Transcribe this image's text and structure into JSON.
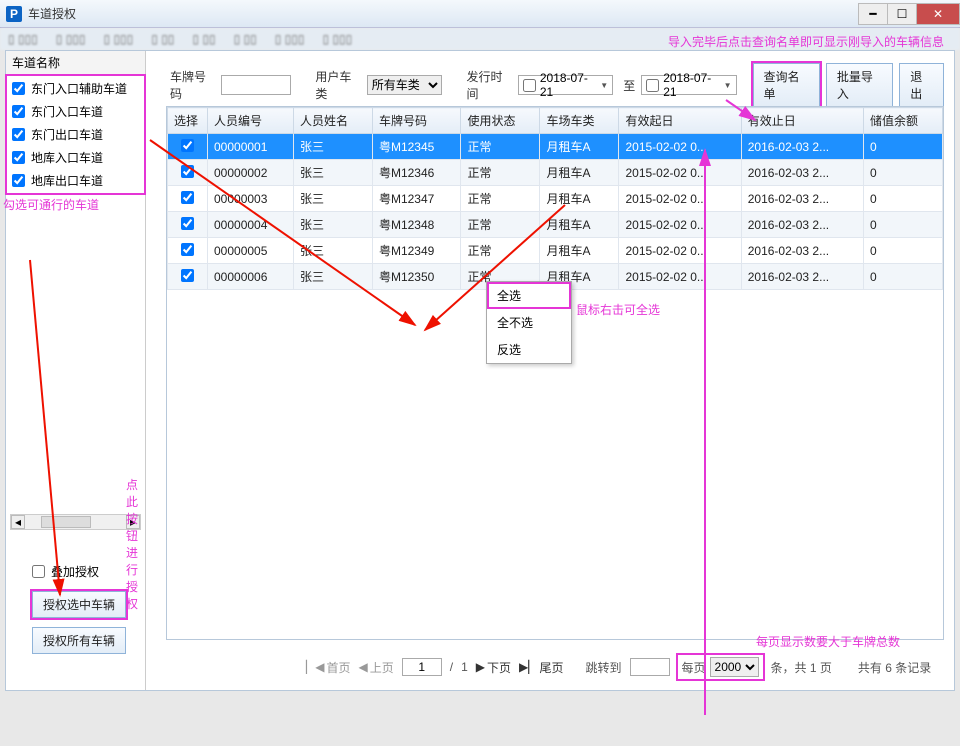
{
  "window": {
    "title": "车道授权"
  },
  "sidebar": {
    "heading": "车道名称",
    "lanes": [
      "东门入口辅助车道",
      "东门入口车道",
      "东门出口车道",
      "地库入口车道",
      "地库出口车道"
    ]
  },
  "annotations": {
    "top_note": "导入完毕后点击查询名单即可显示刚导入的车辆信息",
    "lane_note": "勾选可通行的车道",
    "ctx_note": "鼠标右击可全选",
    "pager_note": "每页显示数要大于车牌总数",
    "auth_note": "点此按钮进行授权"
  },
  "filters": {
    "plate_label": "车牌号码",
    "plate_value": "",
    "user_class_label": "用户车类",
    "user_class_value": "所有车类",
    "issue_time_label": "发行时间",
    "date_from": "2018-07-21",
    "to_label": "至",
    "date_to": "2018-07-21"
  },
  "buttons": {
    "query": "查询名单",
    "batch_import": "批量导入",
    "exit": "退出",
    "auth_selected": "授权选中车辆",
    "auth_all": "授权所有车辆",
    "stack_auth": "叠加授权"
  },
  "table": {
    "headers": [
      "选择",
      "人员编号",
      "人员姓名",
      "车牌号码",
      "使用状态",
      "车场车类",
      "有效起日",
      "有效止日",
      "储值余额"
    ],
    "rows": [
      {
        "sel": true,
        "id": "00000001",
        "name": "张三",
        "plate": "粤M12345",
        "status": "正常",
        "cls": "月租车A",
        "start": "2015-02-02 0...",
        "end": "2016-02-03 2...",
        "bal": "0",
        "selected": true
      },
      {
        "sel": true,
        "id": "00000002",
        "name": "张三",
        "plate": "粤M12346",
        "status": "正常",
        "cls": "月租车A",
        "start": "2015-02-02 0...",
        "end": "2016-02-03 2...",
        "bal": "0"
      },
      {
        "sel": true,
        "id": "00000003",
        "name": "张三",
        "plate": "粤M12347",
        "status": "正常",
        "cls": "月租车A",
        "start": "2015-02-02 0...",
        "end": "2016-02-03 2...",
        "bal": "0"
      },
      {
        "sel": true,
        "id": "00000004",
        "name": "张三",
        "plate": "粤M12348",
        "status": "正常",
        "cls": "月租车A",
        "start": "2015-02-02 0...",
        "end": "2016-02-03 2...",
        "bal": "0"
      },
      {
        "sel": true,
        "id": "00000005",
        "name": "张三",
        "plate": "粤M12349",
        "status": "正常",
        "cls": "月租车A",
        "start": "2015-02-02 0...",
        "end": "2016-02-03 2...",
        "bal": "0"
      },
      {
        "sel": true,
        "id": "00000006",
        "name": "张三",
        "plate": "粤M12350",
        "status": "正常",
        "cls": "月租车A",
        "start": "2015-02-02 0...",
        "end": "2016-02-03 2...",
        "bal": "0"
      }
    ]
  },
  "context_menu": {
    "select_all": "全选",
    "select_none": "全不选",
    "invert": "反选"
  },
  "pager": {
    "first": "首页",
    "prev": "上页",
    "page": "1",
    "total_pages": "1",
    "next": "下页",
    "last": "尾页",
    "jump_label": "跳转到",
    "jump_value": "",
    "per_page_label": "每页",
    "per_page_value": "2000",
    "suffix1": "条，共 1 页",
    "suffix2": "共有 6 条记录"
  }
}
